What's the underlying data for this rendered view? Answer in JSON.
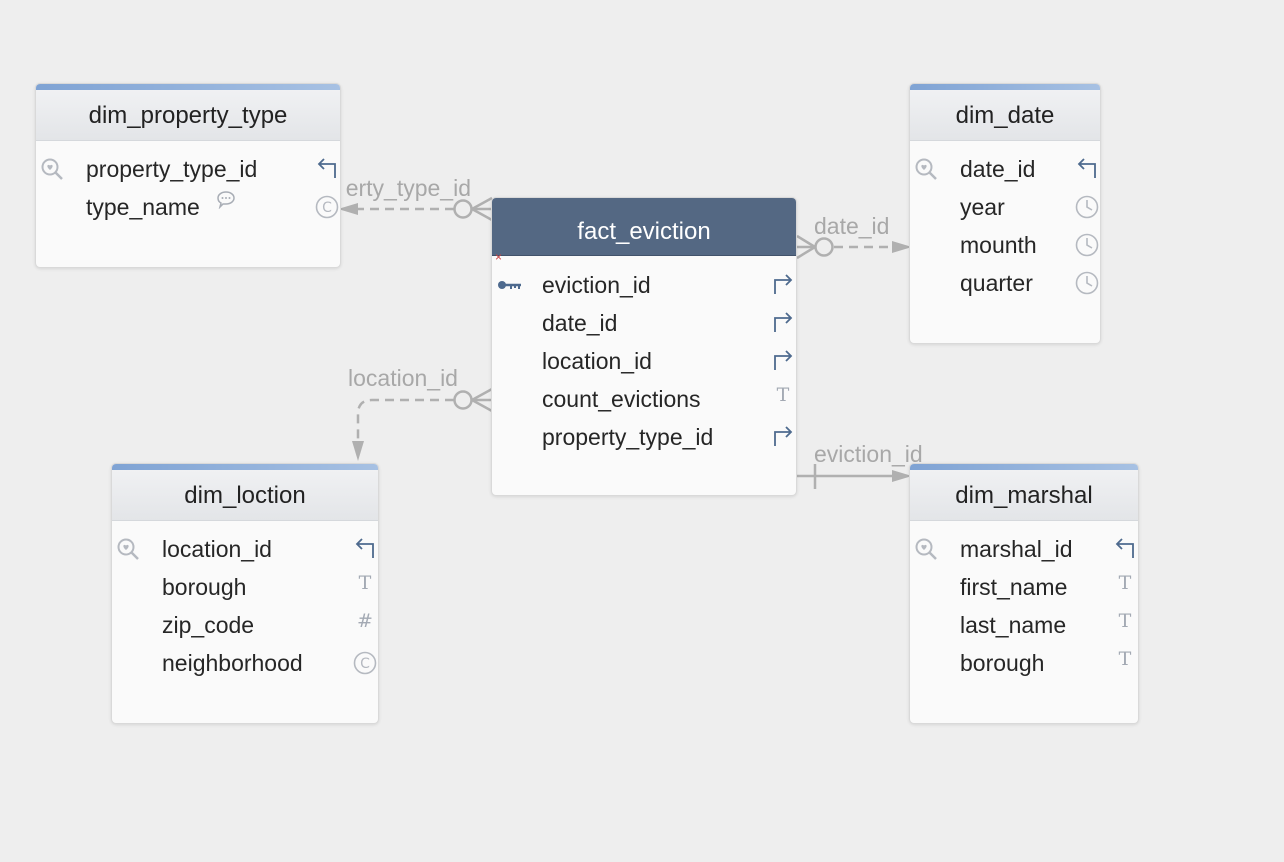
{
  "entities": {
    "dim_property_type": {
      "name": "dim_property_type",
      "fields": [
        {
          "name": "property_type_id",
          "type_icon": "key-ref-icon"
        },
        {
          "name": "type_name",
          "type_icon": "char-icon"
        }
      ]
    },
    "fact_eviction": {
      "name": "fact_eviction",
      "fields": [
        {
          "name": "eviction_id",
          "type_icon": "foreign-key-arrow-icon"
        },
        {
          "name": "date_id",
          "type_icon": "foreign-key-arrow-icon"
        },
        {
          "name": "location_id",
          "type_icon": "foreign-key-arrow-icon"
        },
        {
          "name": "count_evictions",
          "type_icon": "text-icon"
        },
        {
          "name": "property_type_id",
          "type_icon": "foreign-key-arrow-icon"
        }
      ]
    },
    "dim_date": {
      "name": "dim_date",
      "fields": [
        {
          "name": "date_id",
          "type_icon": "key-ref-icon"
        },
        {
          "name": "year",
          "type_icon": "clock-icon"
        },
        {
          "name": "mounth",
          "type_icon": "clock-icon"
        },
        {
          "name": "quarter",
          "type_icon": "clock-icon"
        }
      ]
    },
    "dim_loction": {
      "name": "dim_loction",
      "fields": [
        {
          "name": "location_id",
          "type_icon": "key-ref-icon"
        },
        {
          "name": "borough",
          "type_icon": "text-icon"
        },
        {
          "name": "zip_code",
          "type_icon": "hash-icon"
        },
        {
          "name": "neighborhood",
          "type_icon": "char-icon"
        }
      ]
    },
    "dim_marshal": {
      "name": "dim_marshal",
      "fields": [
        {
          "name": "marshal_id",
          "type_icon": "key-ref-icon"
        },
        {
          "name": "first_name",
          "type_icon": "text-icon"
        },
        {
          "name": "last_name",
          "type_icon": "text-icon"
        },
        {
          "name": "borough",
          "type_icon": "text-icon"
        }
      ]
    }
  },
  "glyphs": {
    "text_type": "T",
    "number_type": "#",
    "char_type": "C",
    "close_mark": "×"
  },
  "relationships": [
    {
      "label": "erty_type_id",
      "from": "fact_eviction",
      "to": "dim_property_type",
      "style": "dashed",
      "cardinality": "zero-or-many"
    },
    {
      "label": "date_id",
      "from": "fact_eviction",
      "to": "dim_date",
      "style": "dashed",
      "cardinality": "zero-or-many"
    },
    {
      "label": "location_id",
      "from": "fact_eviction",
      "to": "dim_loction",
      "style": "dashed",
      "cardinality": "zero-or-many"
    },
    {
      "label": "eviction_id",
      "from": "fact_eviction",
      "to": "dim_marshal",
      "style": "solid",
      "cardinality": "one"
    }
  ],
  "colors": {
    "background": "#eeeeee",
    "fact_header": "#546883",
    "accent": "#7fa3d4",
    "connector": "#b0b0b0",
    "icon": "#4e6a8e"
  }
}
